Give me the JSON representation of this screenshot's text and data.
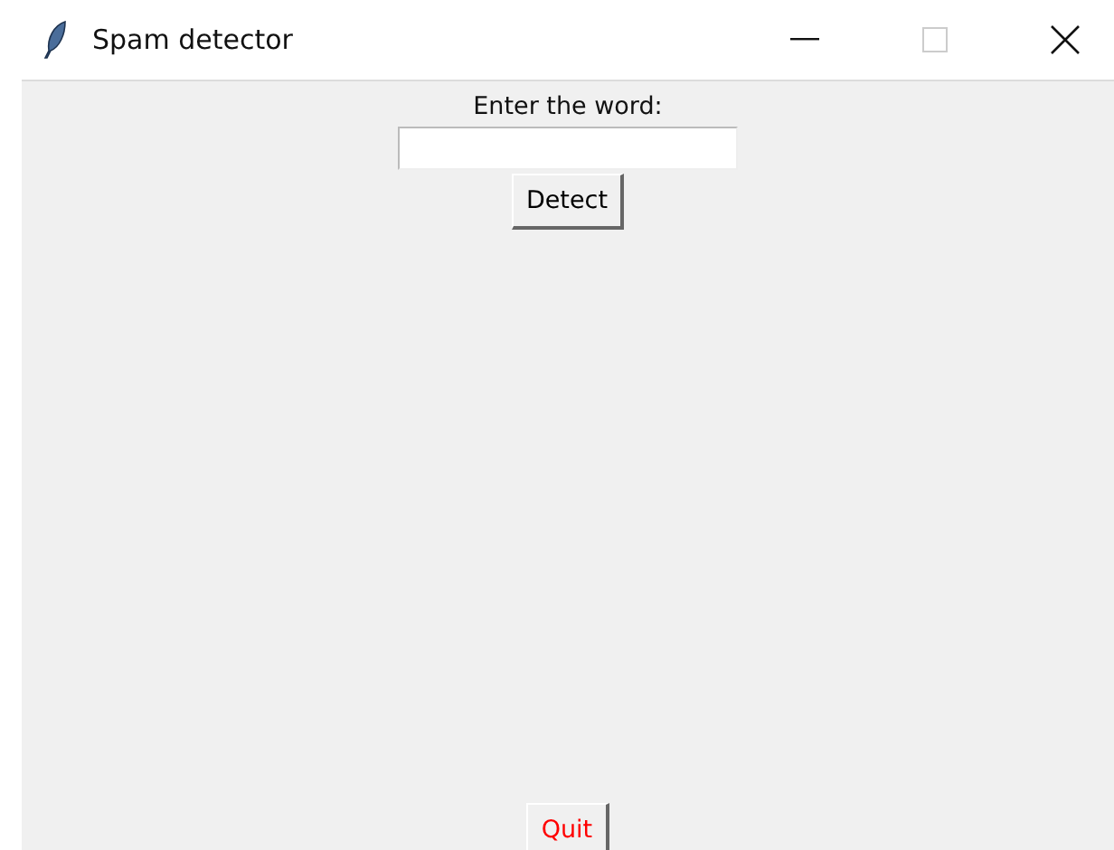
{
  "window": {
    "title": "Spam detector",
    "maximize_disabled": true
  },
  "prompt": "Enter the word:",
  "buttons": [
    {
      "label": "Detect",
      "color": "#000000"
    },
    {
      "label": "Quit",
      "color": "#ff0000"
    }
  ]
}
